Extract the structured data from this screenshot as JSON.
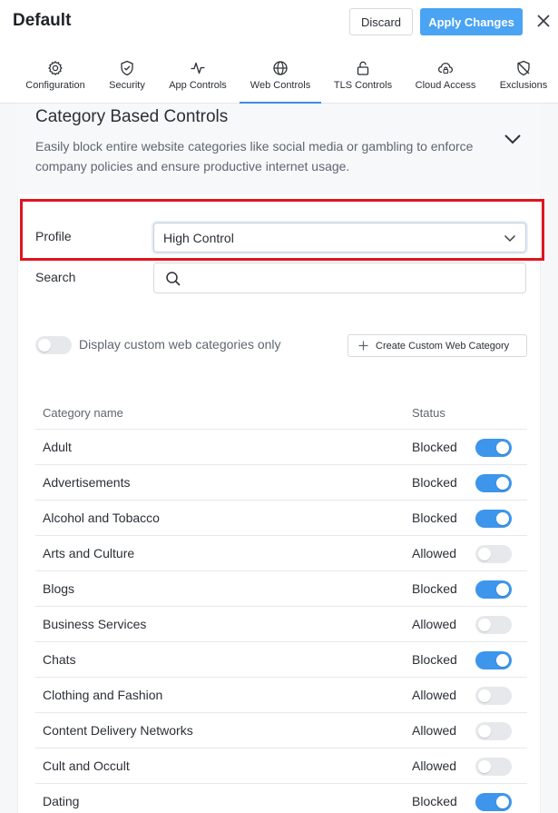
{
  "header": {
    "title": "Default",
    "discard_label": "Discard",
    "apply_label": "Apply Changes"
  },
  "tabs": [
    {
      "label": "Configuration",
      "icon": "gear-icon"
    },
    {
      "label": "Security",
      "icon": "shield-icon"
    },
    {
      "label": "App Controls",
      "icon": "pulse-icon"
    },
    {
      "label": "Web Controls",
      "icon": "globe-icon",
      "active": true
    },
    {
      "label": "TLS Controls",
      "icon": "lock-icon"
    },
    {
      "label": "Cloud Access",
      "icon": "cloud-lock-icon"
    },
    {
      "label": "Exclusions",
      "icon": "shield-off-icon"
    }
  ],
  "section": {
    "title": "Category Based Controls",
    "description": "Easily block entire website categories like social media or gambling to enforce company policies and ensure productive internet usage."
  },
  "profile": {
    "label": "Profile",
    "value": "High Control"
  },
  "search": {
    "label": "Search",
    "value": ""
  },
  "custom_filter": {
    "label": "Display custom web categories only",
    "enabled": false
  },
  "create_button_label": "Create Custom Web Category",
  "table": {
    "headers": {
      "name": "Category name",
      "status": "Status"
    },
    "rows": [
      {
        "name": "Adult",
        "status": "Blocked",
        "blocked": true
      },
      {
        "name": "Advertisements",
        "status": "Blocked",
        "blocked": true
      },
      {
        "name": "Alcohol and Tobacco",
        "status": "Blocked",
        "blocked": true
      },
      {
        "name": "Arts and Culture",
        "status": "Allowed",
        "blocked": false
      },
      {
        "name": "Blogs",
        "status": "Blocked",
        "blocked": true
      },
      {
        "name": "Business Services",
        "status": "Allowed",
        "blocked": false
      },
      {
        "name": "Chats",
        "status": "Blocked",
        "blocked": true
      },
      {
        "name": "Clothing and Fashion",
        "status": "Allowed",
        "blocked": false
      },
      {
        "name": "Content Delivery Networks",
        "status": "Allowed",
        "blocked": false
      },
      {
        "name": "Cult and Occult",
        "status": "Allowed",
        "blocked": false
      },
      {
        "name": "Dating",
        "status": "Blocked",
        "blocked": true
      }
    ]
  },
  "colors": {
    "accent": "#3d95ec",
    "apply_button": "#4aa3f3",
    "highlight": "#e0141e"
  }
}
